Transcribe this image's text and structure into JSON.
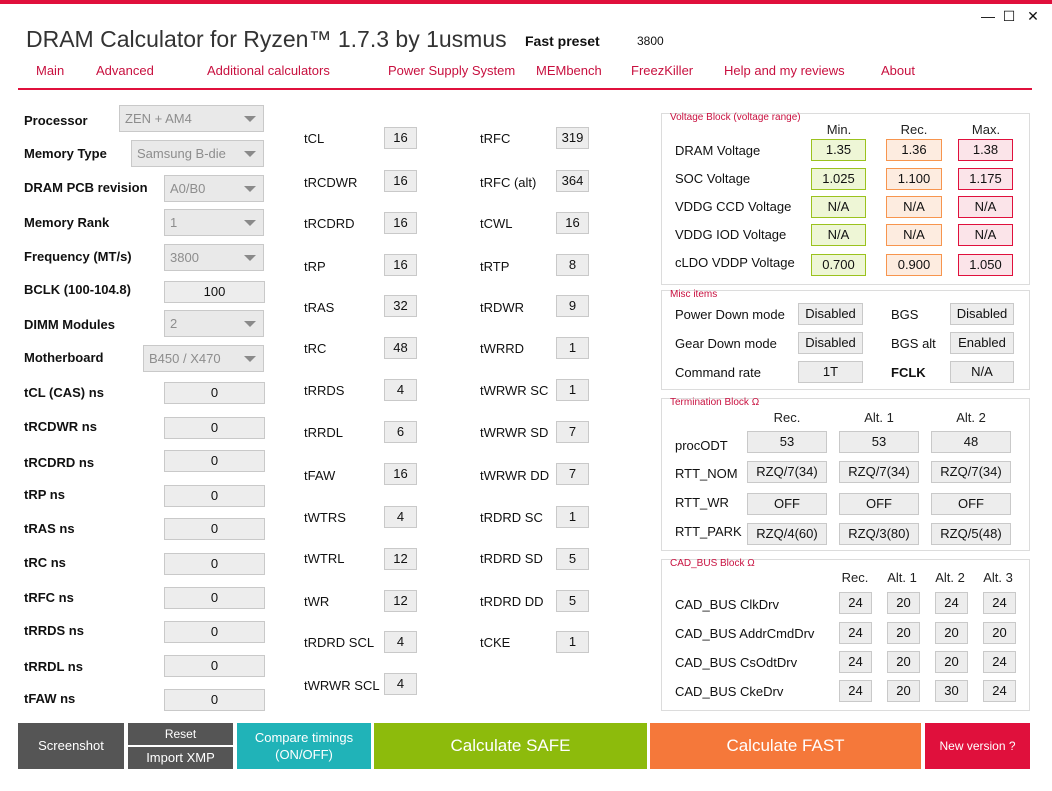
{
  "window": {
    "title": "DRAM Calculator for Ryzen™ 1.7.3 by 1usmus",
    "minimize": "—",
    "maximize": "☐",
    "close": "✕"
  },
  "preset": {
    "label": "Fast preset",
    "value": "3800"
  },
  "nav": [
    "Main",
    "Advanced",
    "Additional calculators",
    "Power Supply System",
    "MEMbench",
    "FreezKiller",
    "Help and my reviews",
    "About"
  ],
  "left": {
    "processor": {
      "label": "Processor",
      "value": "ZEN + AM4"
    },
    "memory_type": {
      "label": "Memory Type",
      "value": "Samsung B-die"
    },
    "pcb_revision": {
      "label": "DRAM PCB revision",
      "value": "A0/B0"
    },
    "memory_rank": {
      "label": "Memory Rank",
      "value": "1"
    },
    "frequency": {
      "label": "Frequency (MT/s)",
      "value": "3800"
    },
    "bclk": {
      "label": "BCLK (100-104.8)",
      "value": "100"
    },
    "dimm": {
      "label": "DIMM Modules",
      "value": "2"
    },
    "motherboard": {
      "label": "Motherboard",
      "value": "B450 / X470"
    },
    "ns": [
      {
        "label": "tCL (CAS) ns",
        "value": "0"
      },
      {
        "label": "tRCDWR ns",
        "value": "0"
      },
      {
        "label": "tRCDRD ns",
        "value": "0"
      },
      {
        "label": "tRP ns",
        "value": "0"
      },
      {
        "label": "tRAS ns",
        "value": "0"
      },
      {
        "label": "tRC ns",
        "value": "0"
      },
      {
        "label": "tRFC ns",
        "value": "0"
      },
      {
        "label": "tRRDS ns",
        "value": "0"
      },
      {
        "label": "tRRDL ns",
        "value": "0"
      },
      {
        "label": "tFAW ns",
        "value": "0"
      }
    ]
  },
  "timings_a": [
    {
      "label": "tCL",
      "value": "16"
    },
    {
      "label": "tRCDWR",
      "value": "16"
    },
    {
      "label": "tRCDRD",
      "value": "16"
    },
    {
      "label": "tRP",
      "value": "16"
    },
    {
      "label": "tRAS",
      "value": "32"
    },
    {
      "label": "tRC",
      "value": "48"
    },
    {
      "label": "tRRDS",
      "value": "4"
    },
    {
      "label": "tRRDL",
      "value": "6"
    },
    {
      "label": "tFAW",
      "value": "16"
    },
    {
      "label": "tWTRS",
      "value": "4"
    },
    {
      "label": "tWTRL",
      "value": "12"
    },
    {
      "label": "tWR",
      "value": "12"
    },
    {
      "label": "tRDRD SCL",
      "value": "4"
    },
    {
      "label": "tWRWR SCL",
      "value": "4"
    }
  ],
  "timings_b": [
    {
      "label": "tRFC",
      "value": "319"
    },
    {
      "label": "tRFC (alt)",
      "value": "364"
    },
    {
      "label": "tCWL",
      "value": "16"
    },
    {
      "label": "tRTP",
      "value": "8"
    },
    {
      "label": "tRDWR",
      "value": "9"
    },
    {
      "label": "tWRRD",
      "value": "1"
    },
    {
      "label": "tWRWR SC",
      "value": "1"
    },
    {
      "label": "tWRWR SD",
      "value": "7"
    },
    {
      "label": "tWRWR DD",
      "value": "7"
    },
    {
      "label": "tRDRD SC",
      "value": "1"
    },
    {
      "label": "tRDRD SD",
      "value": "5"
    },
    {
      "label": "tRDRD DD",
      "value": "5"
    },
    {
      "label": "tCKE",
      "value": "1"
    }
  ],
  "voltage": {
    "title": "Voltage Block (voltage range)",
    "headers": [
      "Min.",
      "Rec.",
      "Max."
    ],
    "rows": [
      {
        "label": "DRAM Voltage",
        "min": "1.35",
        "rec": "1.36",
        "max": "1.38"
      },
      {
        "label": "SOC Voltage",
        "min": "1.025",
        "rec": "1.100",
        "max": "1.175"
      },
      {
        "label": "VDDG  CCD Voltage",
        "min": "N/A",
        "rec": "N/A",
        "max": "N/A"
      },
      {
        "label": "VDDG  IOD Voltage",
        "min": "N/A",
        "rec": "N/A",
        "max": "N/A"
      },
      {
        "label": "cLDO VDDP Voltage",
        "min": "0.700",
        "rec": "0.900",
        "max": "1.050"
      }
    ]
  },
  "misc": {
    "title": "Misc items",
    "power_down": {
      "label": "Power Down mode",
      "value": "Disabled"
    },
    "gear_down": {
      "label": "Gear Down mode",
      "value": "Disabled"
    },
    "command_rate": {
      "label": "Command rate",
      "value": "1T"
    },
    "bgs": {
      "label": "BGS",
      "value": "Disabled"
    },
    "bgs_alt": {
      "label": "BGS alt",
      "value": "Enabled"
    },
    "fclk": {
      "label": "FCLK",
      "value": "N/A"
    }
  },
  "termination": {
    "title": "Termination Block Ω",
    "headers": [
      "Rec.",
      "Alt. 1",
      "Alt. 2"
    ],
    "rows": [
      {
        "label": "procODT",
        "values": [
          "53",
          "53",
          "48"
        ]
      },
      {
        "label": "RTT_NOM",
        "values": [
          "RZQ/7(34)",
          "RZQ/7(34)",
          "RZQ/7(34)"
        ]
      },
      {
        "label": "RTT_WR",
        "values": [
          "OFF",
          "OFF",
          "OFF"
        ]
      },
      {
        "label": "RTT_PARK",
        "values": [
          "RZQ/4(60)",
          "RZQ/3(80)",
          "RZQ/5(48)"
        ]
      }
    ]
  },
  "cadbus": {
    "title": "CAD_BUS Block Ω",
    "headers": [
      "Rec.",
      "Alt. 1",
      "Alt. 2",
      "Alt. 3"
    ],
    "rows": [
      {
        "label": "CAD_BUS ClkDrv",
        "values": [
          "24",
          "20",
          "24",
          "24"
        ]
      },
      {
        "label": "CAD_BUS AddrCmdDrv",
        "values": [
          "24",
          "20",
          "20",
          "20"
        ]
      },
      {
        "label": "CAD_BUS CsOdtDrv",
        "values": [
          "24",
          "20",
          "20",
          "24"
        ]
      },
      {
        "label": "CAD_BUS CkeDrv",
        "values": [
          "24",
          "20",
          "30",
          "24"
        ]
      }
    ]
  },
  "buttons": {
    "screenshot": "Screenshot",
    "reset": "Reset",
    "import_xmp": "Import XMP",
    "compare_line1": "Compare timings",
    "compare_line2": "(ON/OFF)",
    "calc_safe": "Calculate SAFE",
    "calc_fast": "Calculate FAST",
    "new_version": "New version ?"
  },
  "colors": {
    "accent": "#e0103c",
    "safe": "#8dbb0c",
    "fast": "#f5783a",
    "compare": "#20b3b8",
    "dark_button": "#555555"
  }
}
